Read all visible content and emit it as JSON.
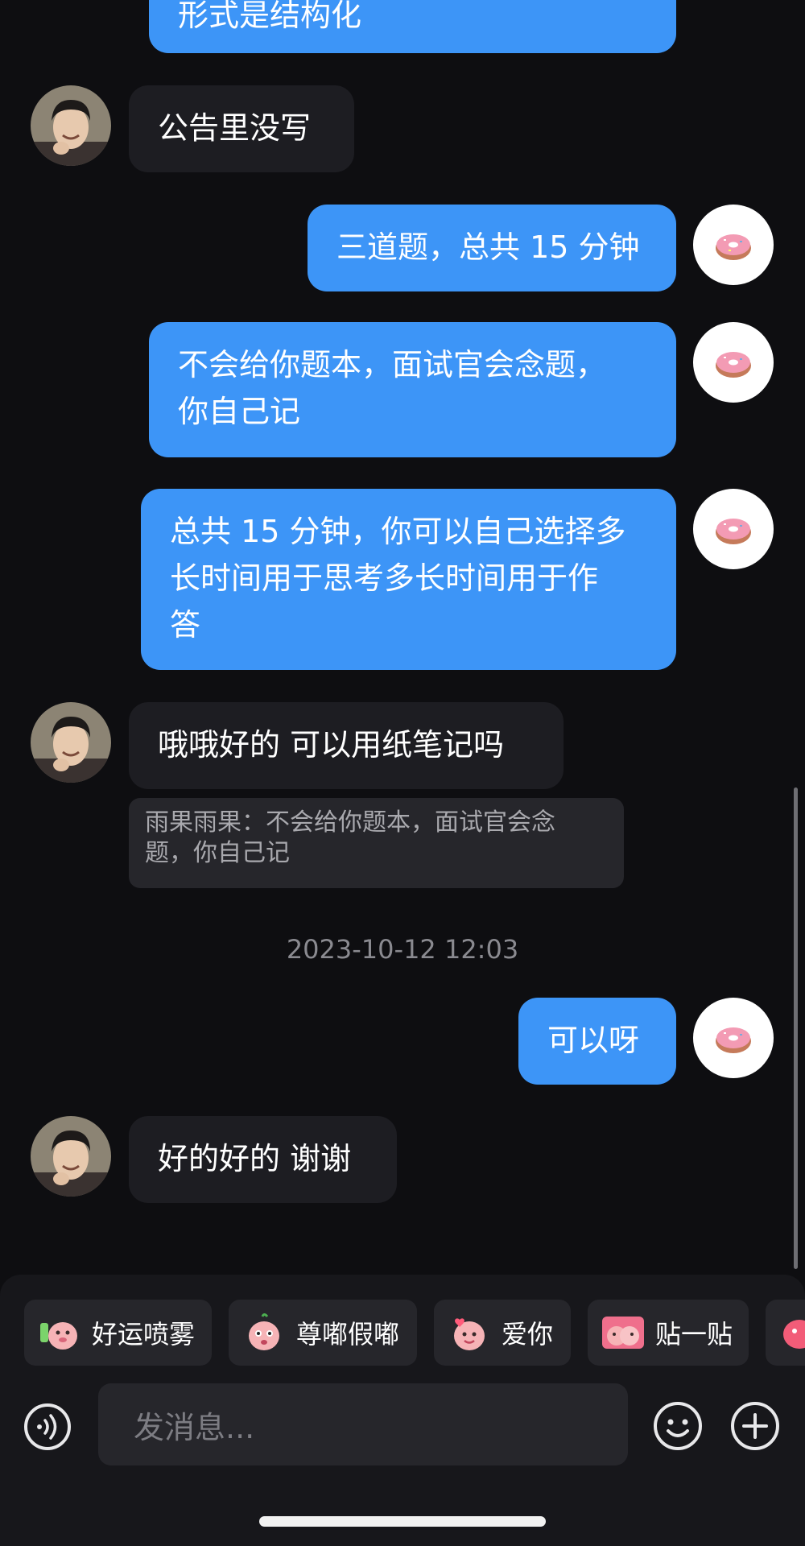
{
  "messages": {
    "m0": {
      "text": "形式是结构化",
      "side": "out"
    },
    "m1": {
      "text": "公告里没写",
      "side": "in"
    },
    "m2": {
      "text": "三道题，总共 15 分钟",
      "side": "out"
    },
    "m3": {
      "line1": "不会给你题本，面试官会念题，",
      "line2": "你自己记",
      "side": "out"
    },
    "m4": {
      "line1": "总共 15 分钟，你可以自己选择多",
      "line2": "长时间用于思考多长时间用于作",
      "line3": "答",
      "side": "out"
    },
    "m5": {
      "text": "哦哦好的 可以用纸笔记吗",
      "side": "in"
    },
    "m5_quote": {
      "line1": "雨果雨果：不会给你题本，面试官会念",
      "line2": "题，你自己记"
    },
    "m6": {
      "text": "可以呀",
      "side": "out"
    },
    "m7": {
      "text": "好的好的 谢谢",
      "side": "in"
    }
  },
  "timestamp": "2023-10-12 12:03",
  "quick_reactions": [
    {
      "label": "好运喷雾",
      "icon": "pink-blob-spray-sticker"
    },
    {
      "label": "尊嘟假嘟",
      "icon": "pink-blob-surprised-sticker"
    },
    {
      "label": "爱你",
      "icon": "pink-blob-heart-sticker"
    },
    {
      "label": "贴一贴",
      "icon": "pink-blob-hug-sticker"
    }
  ],
  "composer": {
    "placeholder": "发消息..."
  },
  "colors": {
    "background": "#0e0e11",
    "outgoing_bubble": "#3d95f7",
    "incoming_bubble": "#1d1d22",
    "quote_bubble": "#26262b"
  }
}
